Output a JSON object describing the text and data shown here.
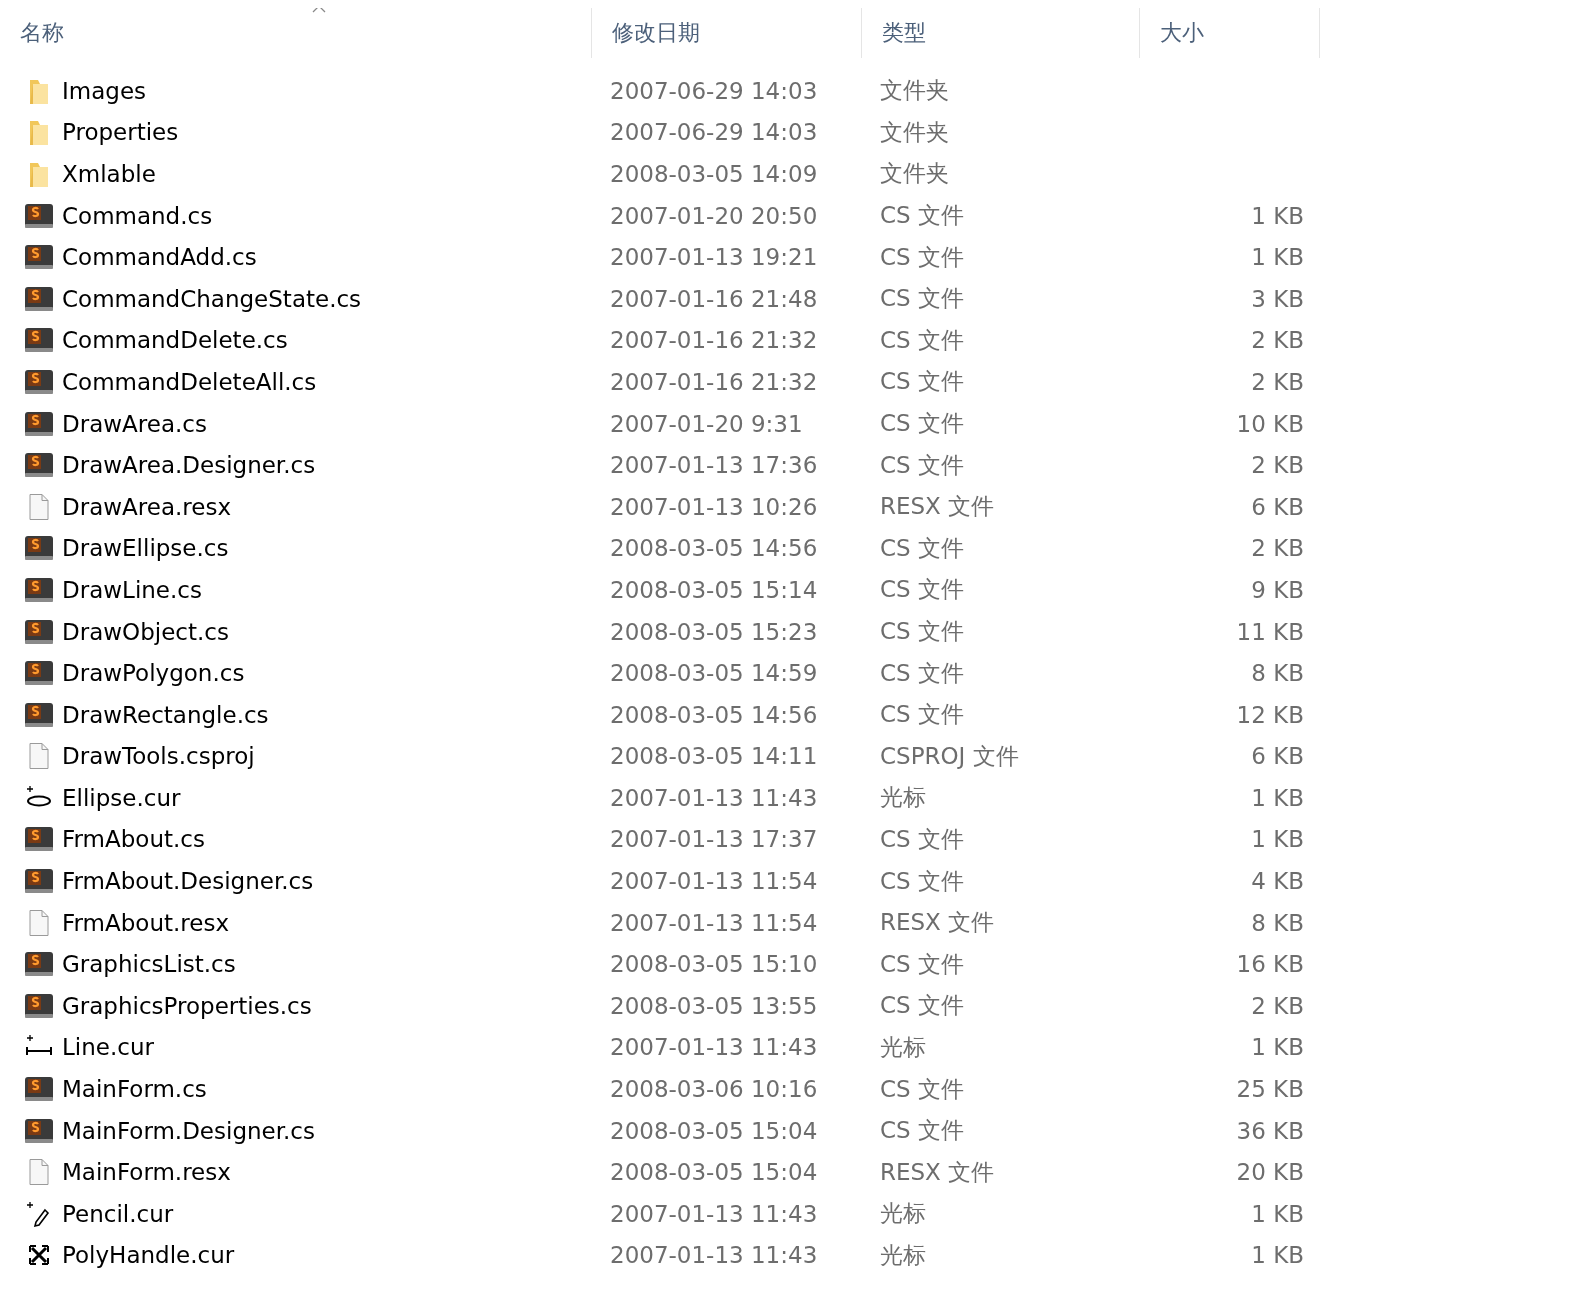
{
  "columns": [
    {
      "label": "名称",
      "sorted": true
    },
    {
      "label": "修改日期",
      "sorted": false
    },
    {
      "label": "类型",
      "sorted": false
    },
    {
      "label": "大小",
      "sorted": false
    }
  ],
  "rows": [
    {
      "kind": "folder",
      "name": "Images",
      "date": "2007-06-29 14:03",
      "type": "文件夹",
      "size": ""
    },
    {
      "kind": "folder",
      "name": "Properties",
      "date": "2007-06-29 14:03",
      "type": "文件夹",
      "size": ""
    },
    {
      "kind": "folder",
      "name": "Xmlable",
      "date": "2008-03-05 14:09",
      "type": "文件夹",
      "size": ""
    },
    {
      "kind": "cs",
      "name": "Command.cs",
      "date": "2007-01-20 20:50",
      "type": "CS 文件",
      "size": "1 KB"
    },
    {
      "kind": "cs",
      "name": "CommandAdd.cs",
      "date": "2007-01-13 19:21",
      "type": "CS 文件",
      "size": "1 KB"
    },
    {
      "kind": "cs",
      "name": "CommandChangeState.cs",
      "date": "2007-01-16 21:48",
      "type": "CS 文件",
      "size": "3 KB"
    },
    {
      "kind": "cs",
      "name": "CommandDelete.cs",
      "date": "2007-01-16 21:32",
      "type": "CS 文件",
      "size": "2 KB"
    },
    {
      "kind": "cs",
      "name": "CommandDeleteAll.cs",
      "date": "2007-01-16 21:32",
      "type": "CS 文件",
      "size": "2 KB"
    },
    {
      "kind": "cs",
      "name": "DrawArea.cs",
      "date": "2007-01-20 9:31",
      "type": "CS 文件",
      "size": "10 KB"
    },
    {
      "kind": "cs",
      "name": "DrawArea.Designer.cs",
      "date": "2007-01-13 17:36",
      "type": "CS 文件",
      "size": "2 KB"
    },
    {
      "kind": "blank",
      "name": "DrawArea.resx",
      "date": "2007-01-13 10:26",
      "type": "RESX 文件",
      "size": "6 KB"
    },
    {
      "kind": "cs",
      "name": "DrawEllipse.cs",
      "date": "2008-03-05 14:56",
      "type": "CS 文件",
      "size": "2 KB"
    },
    {
      "kind": "cs",
      "name": "DrawLine.cs",
      "date": "2008-03-05 15:14",
      "type": "CS 文件",
      "size": "9 KB"
    },
    {
      "kind": "cs",
      "name": "DrawObject.cs",
      "date": "2008-03-05 15:23",
      "type": "CS 文件",
      "size": "11 KB"
    },
    {
      "kind": "cs",
      "name": "DrawPolygon.cs",
      "date": "2008-03-05 14:59",
      "type": "CS 文件",
      "size": "8 KB"
    },
    {
      "kind": "cs",
      "name": "DrawRectangle.cs",
      "date": "2008-03-05 14:56",
      "type": "CS 文件",
      "size": "12 KB"
    },
    {
      "kind": "blank",
      "name": "DrawTools.csproj",
      "date": "2008-03-05 14:11",
      "type": "CSPROJ 文件",
      "size": "6 KB"
    },
    {
      "kind": "ellipse",
      "name": "Ellipse.cur",
      "date": "2007-01-13 11:43",
      "type": "光标",
      "size": "1 KB"
    },
    {
      "kind": "cs",
      "name": "FrmAbout.cs",
      "date": "2007-01-13 17:37",
      "type": "CS 文件",
      "size": "1 KB"
    },
    {
      "kind": "cs",
      "name": "FrmAbout.Designer.cs",
      "date": "2007-01-13 11:54",
      "type": "CS 文件",
      "size": "4 KB"
    },
    {
      "kind": "blank",
      "name": "FrmAbout.resx",
      "date": "2007-01-13 11:54",
      "type": "RESX 文件",
      "size": "8 KB"
    },
    {
      "kind": "cs",
      "name": "GraphicsList.cs",
      "date": "2008-03-05 15:10",
      "type": "CS 文件",
      "size": "16 KB"
    },
    {
      "kind": "cs",
      "name": "GraphicsProperties.cs",
      "date": "2008-03-05 13:55",
      "type": "CS 文件",
      "size": "2 KB"
    },
    {
      "kind": "line",
      "name": "Line.cur",
      "date": "2007-01-13 11:43",
      "type": "光标",
      "size": "1 KB"
    },
    {
      "kind": "cs",
      "name": "MainForm.cs",
      "date": "2008-03-06 10:16",
      "type": "CS 文件",
      "size": "25 KB"
    },
    {
      "kind": "cs",
      "name": "MainForm.Designer.cs",
      "date": "2008-03-05 15:04",
      "type": "CS 文件",
      "size": "36 KB"
    },
    {
      "kind": "blank",
      "name": "MainForm.resx",
      "date": "2008-03-05 15:04",
      "type": "RESX 文件",
      "size": "20 KB"
    },
    {
      "kind": "pencil",
      "name": "Pencil.cur",
      "date": "2007-01-13 11:43",
      "type": "光标",
      "size": "1 KB"
    },
    {
      "kind": "move",
      "name": "PolyHandle.cur",
      "date": "2007-01-13 11:43",
      "type": "光标",
      "size": "1 KB"
    }
  ]
}
